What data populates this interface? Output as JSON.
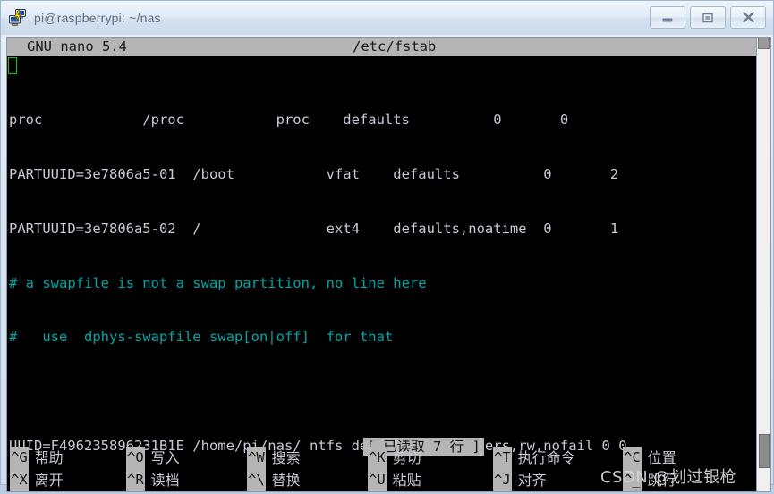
{
  "window": {
    "title": "pi@raspberrypi: ~/nas",
    "icon": "putty-icon",
    "controls": {
      "minimize": "minimize-button",
      "maximize": "maximize-button",
      "close": "close-button"
    }
  },
  "editor": {
    "name": "GNU nano",
    "version_label": "GNU nano 5.4",
    "filename": "/etc/fstab",
    "status_message": "[ 已读取 7 行 ]",
    "lines": [
      {
        "text": "proc            /proc           proc    defaults          0       0",
        "type": "normal"
      },
      {
        "text": "PARTUUID=3e7806a5-01  /boot           vfat    defaults          0       2",
        "type": "normal"
      },
      {
        "text": "PARTUUID=3e7806a5-02  /               ext4    defaults,noatime  0       1",
        "type": "normal"
      },
      {
        "text": "# a swapfile is not a swap partition, no line here",
        "type": "comment"
      },
      {
        "text": "#   use  dphys-swapfile swap[on|off]  for that",
        "type": "comment"
      },
      {
        "text": "",
        "type": "normal"
      },
      {
        "text": "UUID=F496235896231B1E /home/pi/nas/ ntfs defaults,auto,users,rw,nofail 0 0",
        "type": "normal"
      }
    ],
    "cursor": {
      "line": 1,
      "column": 1
    },
    "shortcuts_row1": [
      {
        "key": "^G",
        "label": "帮助"
      },
      {
        "key": "^O",
        "label": "写入"
      },
      {
        "key": "^W",
        "label": "搜索"
      },
      {
        "key": "^K",
        "label": "剪切"
      },
      {
        "key": "^T",
        "label": "执行命令"
      },
      {
        "key": "^C",
        "label": "位置"
      }
    ],
    "shortcuts_row2": [
      {
        "key": "^X",
        "label": "离开"
      },
      {
        "key": "^R",
        "label": "读档"
      },
      {
        "key": "^\\",
        "label": "替换"
      },
      {
        "key": "^U",
        "label": "粘贴"
      },
      {
        "key": "^J",
        "label": "对齐"
      },
      {
        "key": "^_",
        "label": "跳行"
      }
    ]
  },
  "watermark": {
    "text": "CSDN @划过银枪"
  },
  "colors": {
    "terminal_background": "#000000",
    "terminal_foreground": "#c9c9d6",
    "comment": "#00a6a6",
    "cursor_outline": "#14c414",
    "nano_bar_background": "#b5b5b5",
    "nano_bar_foreground": "#141414",
    "titlebar_text": "#5d6b7c"
  }
}
